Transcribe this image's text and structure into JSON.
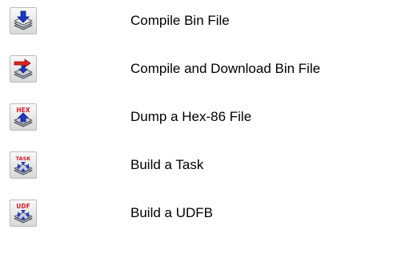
{
  "commands": [
    {
      "label": "Compile Bin File",
      "icon": "compile-bin-icon"
    },
    {
      "label": "Compile and Download Bin File",
      "icon": "compile-download-icon"
    },
    {
      "label": "Dump a Hex-86 File",
      "icon": "hex-dump-icon",
      "badge": "HEX"
    },
    {
      "label": "Build a Task",
      "icon": "build-task-icon",
      "badge": "TASK"
    },
    {
      "label": "Build a UDFB",
      "icon": "build-udfb-icon",
      "badge": "UDF"
    }
  ],
  "colors": {
    "arrow_blue": "#1a39c8",
    "arrow_red": "#e2231a",
    "badge_red": "#d8202a",
    "stack_dark": "#555555"
  }
}
